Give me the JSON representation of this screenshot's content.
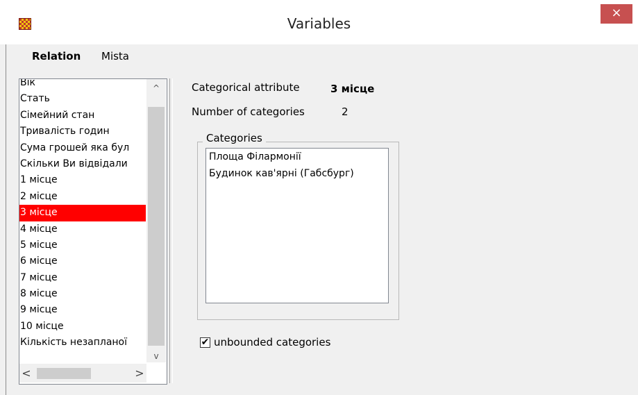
{
  "window": {
    "title": "Variables",
    "close_glyph": "×",
    "app_icon": "rubik-cube-icon"
  },
  "tabs": [
    {
      "label": "Relation",
      "active": true
    },
    {
      "label": "Mista",
      "active": false
    }
  ],
  "variable_list": {
    "items": [
      "Вік",
      "Стать",
      "Сімейний стан",
      "Тривалість годин",
      "Сума грошей яка бул",
      "Скільки Ви відвідали",
      "1 місце",
      "2 місце",
      "3 місце",
      "4 місце",
      "5 місце",
      "6 місце",
      "7 місце",
      "8 місце",
      "9 місце",
      "10 місце",
      "Кількість незапланої"
    ],
    "selected": "3 місце",
    "selected_color": "#ff0000",
    "scroll_up": "^",
    "scroll_down": "v",
    "scroll_left": "<",
    "scroll_right": ">"
  },
  "details": {
    "categorical_attribute_label": "Categorical attribute",
    "categorical_attribute_value": "3 місце",
    "num_categories_label": "Number of categories",
    "num_categories_value": "2",
    "categories_group_label": "Categories",
    "categories": [
      "Площа Філармонії",
      "Будинок кав'ярні (Габсбург)"
    ],
    "unbounded_label": "unbounded categories",
    "unbounded_checked": true,
    "check_glyph": "✔"
  },
  "colors": {
    "close_button": "#c75050",
    "window_bg": "#f0f0f0"
  }
}
